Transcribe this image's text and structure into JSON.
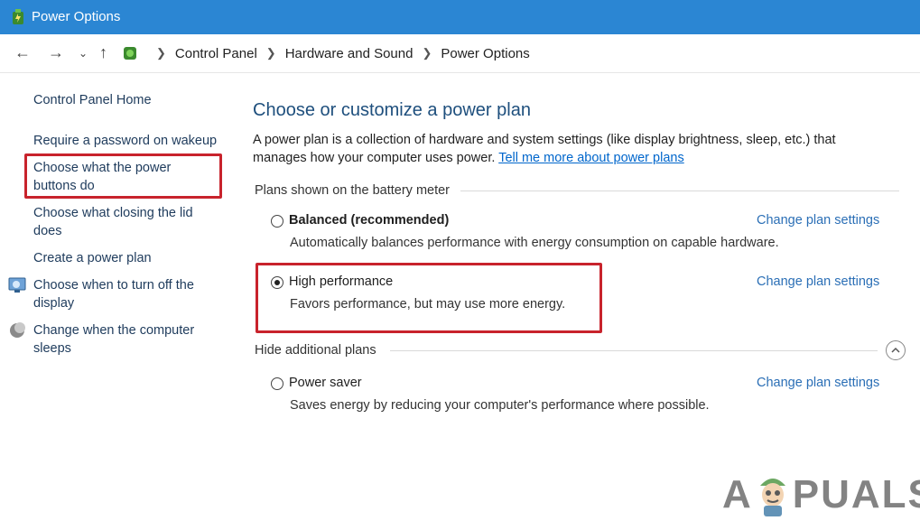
{
  "window": {
    "title": "Power Options"
  },
  "breadcrumb": [
    "Control Panel",
    "Hardware and Sound",
    "Power Options"
  ],
  "sidebar": {
    "home": "Control Panel Home",
    "items": [
      {
        "line1": "Require a password on wakeup",
        "line2": ""
      },
      {
        "line1": "Choose what the power",
        "line2": "buttons do"
      },
      {
        "line1": "Choose what closing the lid",
        "line2": "does"
      },
      {
        "line1": "Create a power plan",
        "line2": ""
      },
      {
        "line1": "Choose when to turn off the",
        "line2": "display"
      },
      {
        "line1": "Change when the computer",
        "line2": "sleeps"
      }
    ]
  },
  "main": {
    "title": "Choose or customize a power plan",
    "description": "A power plan is a collection of hardware and system settings (like display brightness, sleep, etc.) that manages how your computer uses power.",
    "learn_more": "Tell me more about power plans",
    "battery_section": "Plans shown on the battery meter",
    "hidden_section": "Hide additional plans",
    "change_label": "Change plan settings",
    "plans": [
      {
        "name": "Balanced (recommended)",
        "desc": "Automatically balances performance with energy consumption on capable hardware.",
        "selected": false
      },
      {
        "name": "High performance",
        "desc": "Favors performance, but may use more energy.",
        "selected": true
      },
      {
        "name": "Power saver",
        "desc": "Saves energy by reducing your computer's performance where possible.",
        "selected": false
      }
    ]
  },
  "watermark": {
    "text_left": "A",
    "text_right": "PUALS"
  },
  "colors": {
    "titlebar": "#2b86d3",
    "highlight": "#c8232c",
    "link": "#2b6fb6",
    "heading": "#1e4f7d"
  }
}
